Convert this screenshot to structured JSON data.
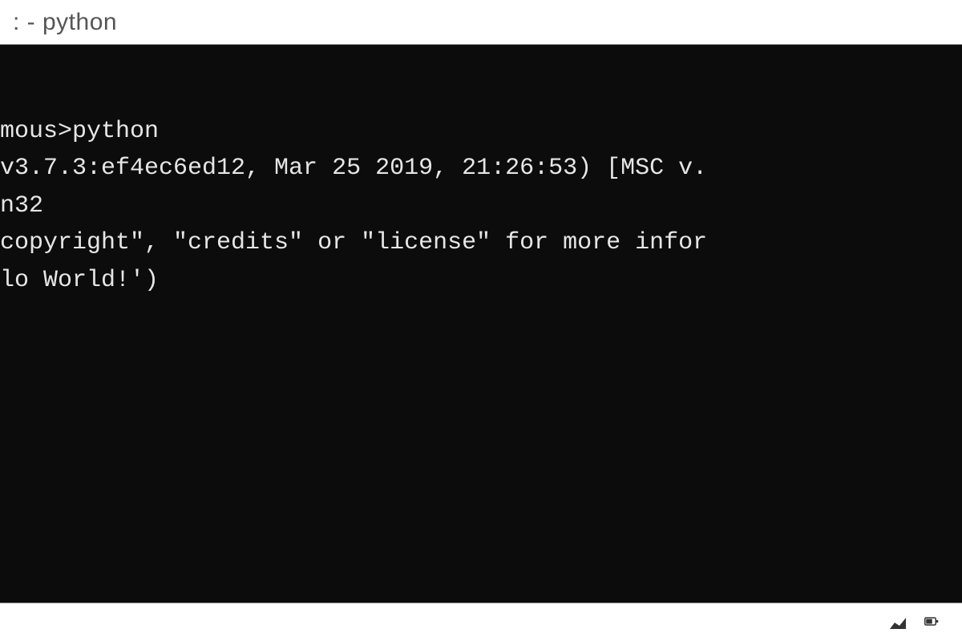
{
  "titlebar": {
    "title": ": - python"
  },
  "terminal": {
    "lines": [
      "mous>python",
      "v3.7.3:ef4ec6ed12, Mar 25 2019, 21:26:53) [MSC v.",
      "n32",
      "copyright\", \"credits\" or \"license\" for more infor",
      "lo World!')"
    ]
  }
}
